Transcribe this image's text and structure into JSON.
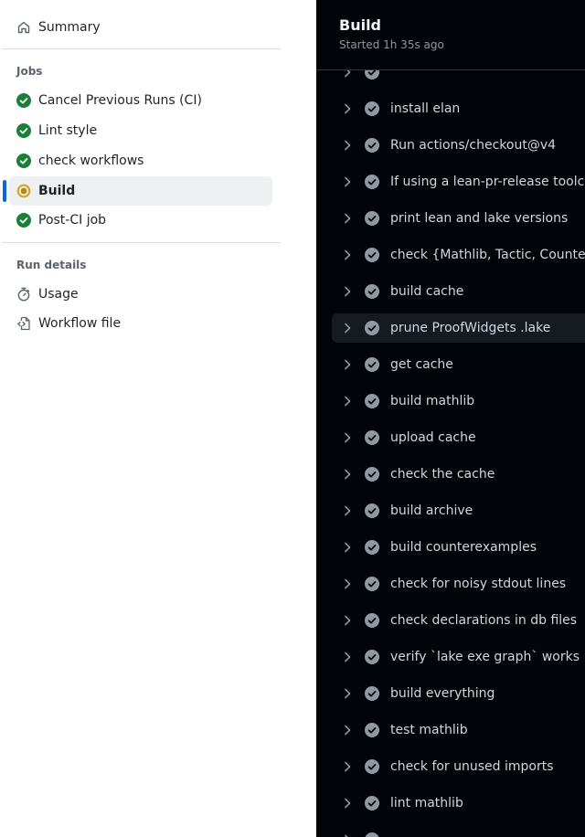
{
  "sidebar": {
    "summary_label": "Summary",
    "jobs_heading": "Jobs",
    "jobs": [
      {
        "label": "Cancel Previous Runs (CI)",
        "status": "success"
      },
      {
        "label": "Lint style",
        "status": "success"
      },
      {
        "label": "check workflows",
        "status": "success"
      },
      {
        "label": "Build",
        "status": "in_progress"
      },
      {
        "label": "Post-CI job",
        "status": "success"
      }
    ],
    "run_details_heading": "Run details",
    "usage_label": "Usage",
    "workflow_file_label": "Workflow file"
  },
  "panel": {
    "title": "Build",
    "subtitle": "Started 1h 35s ago",
    "steps": [
      {
        "name": "install elan"
      },
      {
        "name": "Run actions/checkout@v4"
      },
      {
        "name": "If using a lean-pr-release toolchain, uninstall"
      },
      {
        "name": "print lean and lake versions"
      },
      {
        "name": "check {Mathlib, Tactic, Counterexamples, Archive}.lean"
      },
      {
        "name": "build cache"
      },
      {
        "name": "prune ProofWidgets .lake"
      },
      {
        "name": "get cache"
      },
      {
        "name": "build mathlib"
      },
      {
        "name": "upload cache"
      },
      {
        "name": "check the cache"
      },
      {
        "name": "build archive"
      },
      {
        "name": "build counterexamples"
      },
      {
        "name": "check for noisy stdout lines"
      },
      {
        "name": "check declarations in db files"
      },
      {
        "name": "verify `lake exe graph` works"
      },
      {
        "name": "build everything"
      },
      {
        "name": "test mathlib"
      },
      {
        "name": "check for unused imports"
      },
      {
        "name": "lint mathlib"
      }
    ]
  },
  "colors": {
    "success": "#1a7f37",
    "in_progress": "#bf8700",
    "accent": "#0969da",
    "panel_bg": "#010409"
  }
}
